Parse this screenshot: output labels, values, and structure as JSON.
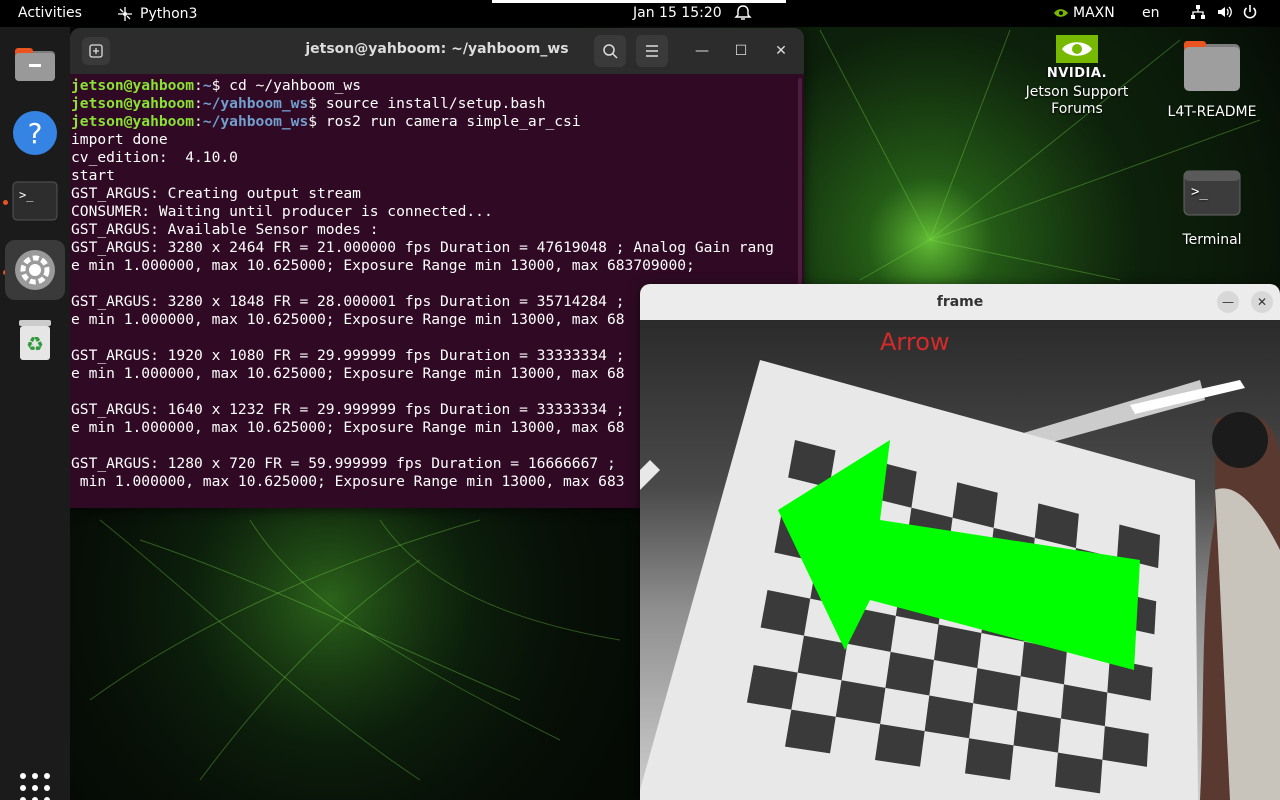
{
  "topbar": {
    "activities": "Activities",
    "app_name": "Python3",
    "clock": "Jan 15  15:20",
    "power_mode": "MAXN",
    "language": "en"
  },
  "dock": {
    "items": [
      {
        "name": "files-icon"
      },
      {
        "name": "help-icon"
      },
      {
        "name": "terminal-icon"
      },
      {
        "name": "settings-icon"
      },
      {
        "name": "trash-icon"
      }
    ]
  },
  "desktop": {
    "nvidia_logo": "NVIDIA.",
    "jetson_forums": "Jetson Support Forums",
    "readme": "L4T-README",
    "terminal": "Terminal"
  },
  "terminal": {
    "title": "jetson@yahboom: ~/yahboom_ws",
    "commands": [
      {
        "user": "jetson@yahboom",
        "path": "~",
        "cmd": "$ cd ~/yahboom_ws"
      },
      {
        "user": "jetson@yahboom",
        "path": "~/yahboom_ws",
        "cmd": "$ source install/setup.bash"
      },
      {
        "user": "jetson@yahboom",
        "path": "~/yahboom_ws",
        "cmd": "$ ros2 run camera simple_ar_csi"
      }
    ],
    "output": [
      "import done",
      "cv_edition:  4.10.0",
      "start",
      "GST_ARGUS: Creating output stream",
      "CONSUMER: Waiting until producer is connected...",
      "GST_ARGUS: Available Sensor modes :",
      "GST_ARGUS: 3280 x 2464 FR = 21.000000 fps Duration = 47619048 ; Analog Gain rang",
      "e min 1.000000, max 10.625000; Exposure Range min 13000, max 683709000;",
      "",
      "GST_ARGUS: 3280 x 1848 FR = 28.000001 fps Duration = 35714284 ;",
      "e min 1.000000, max 10.625000; Exposure Range min 13000, max 68",
      "",
      "GST_ARGUS: 1920 x 1080 FR = 29.999999 fps Duration = 33333334 ;",
      "e min 1.000000, max 10.625000; Exposure Range min 13000, max 68",
      "",
      "GST_ARGUS: 1640 x 1232 FR = 29.999999 fps Duration = 33333334 ;",
      "e min 1.000000, max 10.625000; Exposure Range min 13000, max 68",
      "",
      "GST_ARGUS: 1280 x 720 FR = 59.999999 fps Duration = 16666667 ;",
      " min 1.000000, max 10.625000; Exposure Range min 13000, max 683"
    ]
  },
  "frame_window": {
    "title": "frame",
    "overlay_label": "Arrow",
    "overlay_color": "#00ff00",
    "label_color": "#d42a2a"
  }
}
